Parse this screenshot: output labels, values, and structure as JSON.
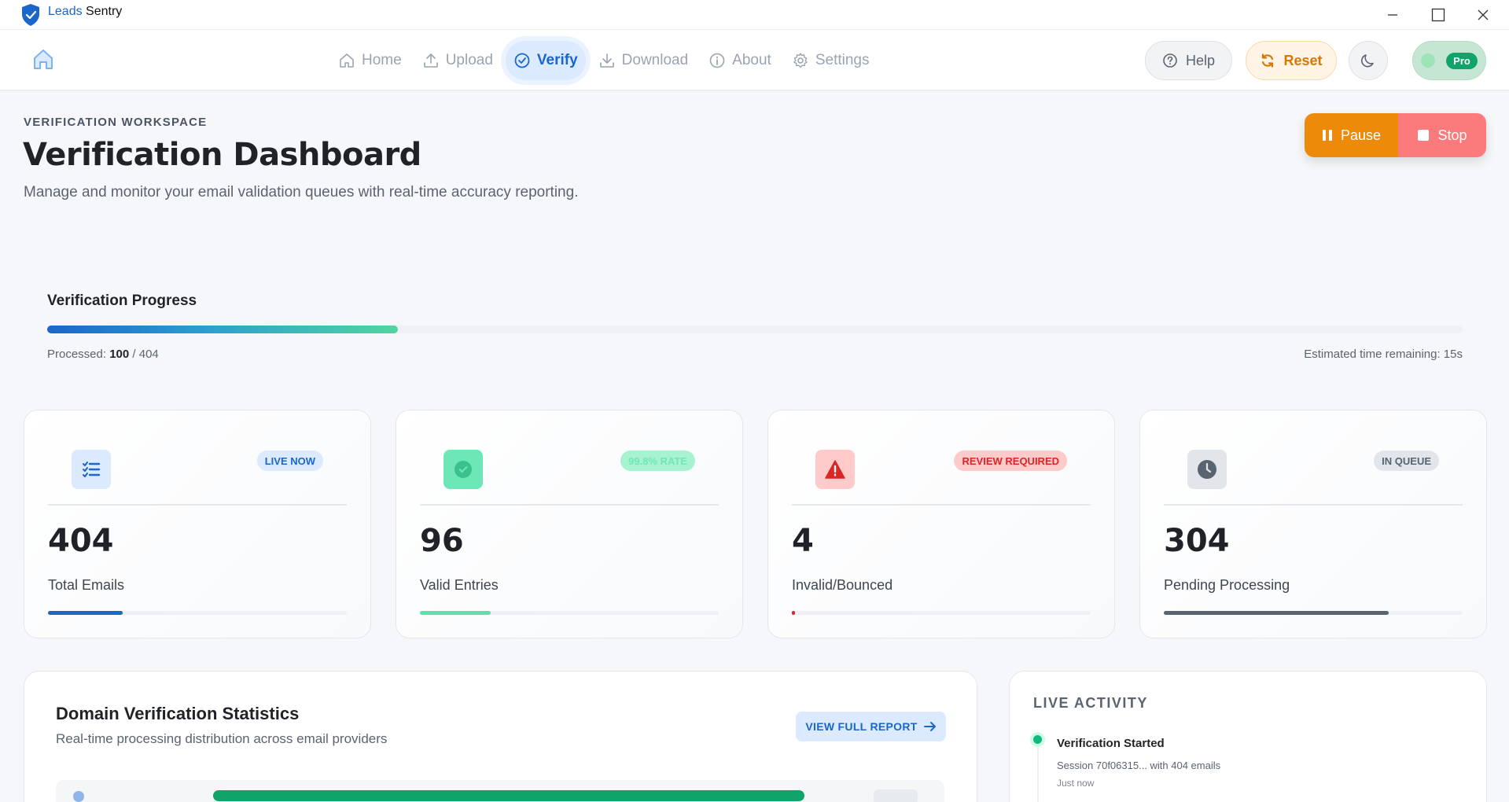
{
  "window": {
    "app_name_part1": "Leads",
    "app_name_part2": " Sentry"
  },
  "nav": {
    "items": [
      {
        "label": "Home",
        "icon": "home-icon"
      },
      {
        "label": "Upload",
        "icon": "upload-icon"
      },
      {
        "label": "Verify",
        "icon": "check-circle-icon",
        "active": true
      },
      {
        "label": "Download",
        "icon": "download-icon"
      },
      {
        "label": "About",
        "icon": "info-icon"
      },
      {
        "label": "Settings",
        "icon": "gear-icon"
      }
    ],
    "help_label": "Help",
    "reset_label": "Reset",
    "pro_label": "Pro"
  },
  "header": {
    "eyebrow": "VERIFICATION WORKSPACE",
    "title": "Verification Dashboard",
    "subtitle": "Manage and monitor your email validation queues with real-time accuracy reporting.",
    "pause_label": "Pause",
    "stop_label": "Stop"
  },
  "progress": {
    "title": "Verification Progress",
    "processed_prefix": "Processed: ",
    "processed": "100",
    "total_text": " / 404",
    "fraction": 0.248,
    "eta": "Estimated time remaining: 15s"
  },
  "stats": [
    {
      "value": "404",
      "label": "Total Emails",
      "badge": "LIVE NOW",
      "bar_fraction": 0.25,
      "color": "#1b66c9",
      "icon": "list-check-icon"
    },
    {
      "value": "96",
      "label": "Valid Entries",
      "badge": "99.8% RATE",
      "bar_fraction": 0.238,
      "color": "#5fe0aa",
      "icon": "check-badge-icon"
    },
    {
      "value": "4",
      "label": "Invalid/Bounced",
      "badge": "REVIEW REQUIRED",
      "bar_fraction": 0.01,
      "color": "#dc2626",
      "icon": "warning-icon"
    },
    {
      "value": "304",
      "label": "Pending Processing",
      "badge": "IN QUEUE",
      "bar_fraction": 0.752,
      "color": "#5a6470",
      "icon": "clock-icon"
    }
  ],
  "domain": {
    "title": "Domain Verification Statistics",
    "subtitle": "Real-time processing distribution across email providers",
    "report_label": "VIEW FULL REPORT"
  },
  "activity": {
    "title": "LIVE ACTIVITY",
    "events": [
      {
        "title": "Verification Started",
        "desc": "Session 70f06315... with 404 emails",
        "time": "Just now"
      }
    ]
  },
  "colors": {
    "accent": "#1b66c9",
    "success": "#10a36a",
    "warning": "#ed8a0a",
    "danger": "#fb7b7d"
  }
}
